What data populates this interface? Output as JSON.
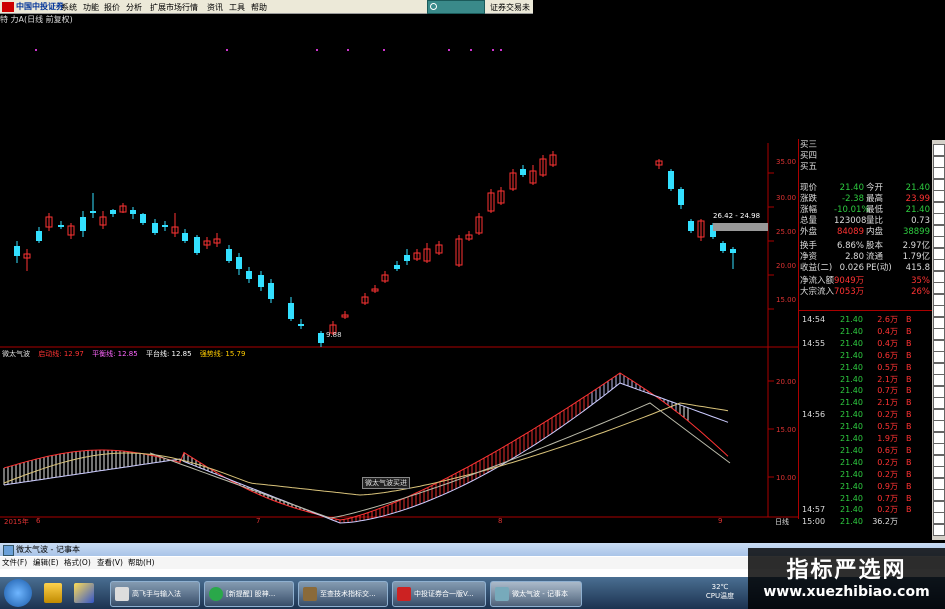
{
  "app": {
    "logo_text": "中国中投证券",
    "menu": [
      "系统",
      "功能",
      "报价",
      "分析",
      "扩展市场行情",
      "资讯",
      "工具",
      "帮助"
    ],
    "trade_tab": "证券交易未",
    "submenu": "特 力A(日线 前复权)"
  },
  "price_axis": [
    "35.00",
    "30.00",
    "25.00",
    "20.00",
    "15.00"
  ],
  "min_label": "9.88",
  "range_label": "26.42 - 24.98",
  "indicator": {
    "header": [
      {
        "text": "微太气波",
        "color": "#ddd"
      },
      {
        "text": "启动线: 12.97",
        "color": "#ff3333"
      },
      {
        "text": "平衡线: 12.85",
        "color": "#ff66ff"
      },
      {
        "text": "平台线: 12.85",
        "color": "#ffffff"
      },
      {
        "text": "强势线: 15.79",
        "color": "#ffcc00"
      }
    ],
    "axis": [
      "20.00",
      "15.00",
      "10.00"
    ],
    "annotation": "微太气波买进"
  },
  "date_axis": [
    "2015年",
    "6",
    "7",
    "8",
    "9"
  ],
  "period_label": "日线",
  "quote": {
    "asks": [
      "买三",
      "买四",
      "买五"
    ],
    "rows": [
      {
        "l1": "现价",
        "v1": "21.40",
        "l2": "今开",
        "v2": "21.40",
        "c1": "g",
        "c2": "g"
      },
      {
        "l1": "涨跌",
        "v1": "-2.38",
        "l2": "最高",
        "v2": "23.99",
        "c1": "g",
        "c2": "r"
      },
      {
        "l1": "涨幅",
        "v1": "-10.01%",
        "l2": "最低",
        "v2": "21.40",
        "c1": "g",
        "c2": "g"
      },
      {
        "l1": "总量",
        "v1": "123008",
        "l2": "量比",
        "v2": "0.73",
        "c1": "w",
        "c2": "w"
      },
      {
        "l1": "外盘",
        "v1": "84089",
        "l2": "内盘",
        "v2": "38899",
        "c1": "r",
        "c2": "g"
      },
      {
        "l1": "换手",
        "v1": "6.86%",
        "l2": "股本",
        "v2": "2.97亿",
        "c1": "w",
        "c2": "w"
      },
      {
        "l1": "净资",
        "v1": "2.80",
        "l2": "流通",
        "v2": "1.79亿",
        "c1": "w",
        "c2": "w"
      },
      {
        "l1": "收益(二)",
        "v1": "0.026",
        "l2": "PE(动)",
        "v2": "415.8",
        "c1": "w",
        "c2": "w"
      },
      {
        "l1": "净流入额",
        "v1": "9049万",
        "l2": "",
        "v2": "35%",
        "c1": "r",
        "c2": "r"
      },
      {
        "l1": "大宗流入",
        "v1": "7053万",
        "l2": "",
        "v2": "26%",
        "c1": "r",
        "c2": "r"
      }
    ]
  },
  "ticks": [
    {
      "t": "14:54",
      "p": "21.40",
      "v": "2.6万",
      "s": "B"
    },
    {
      "t": "",
      "p": "21.40",
      "v": "0.4万",
      "s": "B"
    },
    {
      "t": "14:55",
      "p": "21.40",
      "v": "0.4万",
      "s": "B"
    },
    {
      "t": "",
      "p": "21.40",
      "v": "0.6万",
      "s": "B"
    },
    {
      "t": "",
      "p": "21.40",
      "v": "0.5万",
      "s": "B"
    },
    {
      "t": "",
      "p": "21.40",
      "v": "2.1万",
      "s": "B"
    },
    {
      "t": "",
      "p": "21.40",
      "v": "0.7万",
      "s": "B"
    },
    {
      "t": "",
      "p": "21.40",
      "v": "2.1万",
      "s": "B"
    },
    {
      "t": "14:56",
      "p": "21.40",
      "v": "0.2万",
      "s": "B"
    },
    {
      "t": "",
      "p": "21.40",
      "v": "0.5万",
      "s": "B"
    },
    {
      "t": "",
      "p": "21.40",
      "v": "1.9万",
      "s": "B"
    },
    {
      "t": "",
      "p": "21.40",
      "v": "0.6万",
      "s": "B"
    },
    {
      "t": "",
      "p": "21.40",
      "v": "0.2万",
      "s": "B"
    },
    {
      "t": "",
      "p": "21.40",
      "v": "0.2万",
      "s": "B"
    },
    {
      "t": "",
      "p": "21.40",
      "v": "0.9万",
      "s": "B"
    },
    {
      "t": "",
      "p": "21.40",
      "v": "0.7万",
      "s": "B"
    },
    {
      "t": "14:57",
      "p": "21.40",
      "v": "0.2万",
      "s": "B"
    },
    {
      "t": "15:00",
      "p": "21.40",
      "v": "36.2万",
      "s": ""
    }
  ],
  "notepad": {
    "title": "微太气波 - 记事本",
    "menu": [
      "文件(F)",
      "编辑(E)",
      "格式(O)",
      "查看(V)",
      "帮助(H)"
    ]
  },
  "taskbar": {
    "items": [
      "高飞手与输入法",
      "[新提醒] 股神...",
      "至查技术指标交...",
      "中投证券合一版V...",
      "微太气波 - 记事本"
    ],
    "temp": "32℃",
    "cpu": "CPU温度"
  },
  "watermark": {
    "title": "指标严选网",
    "url": "www.xuezhibiao.com"
  },
  "colors": {
    "up": "#ff3333",
    "down": "#33e0ff",
    "grid": "#aa0000"
  }
}
